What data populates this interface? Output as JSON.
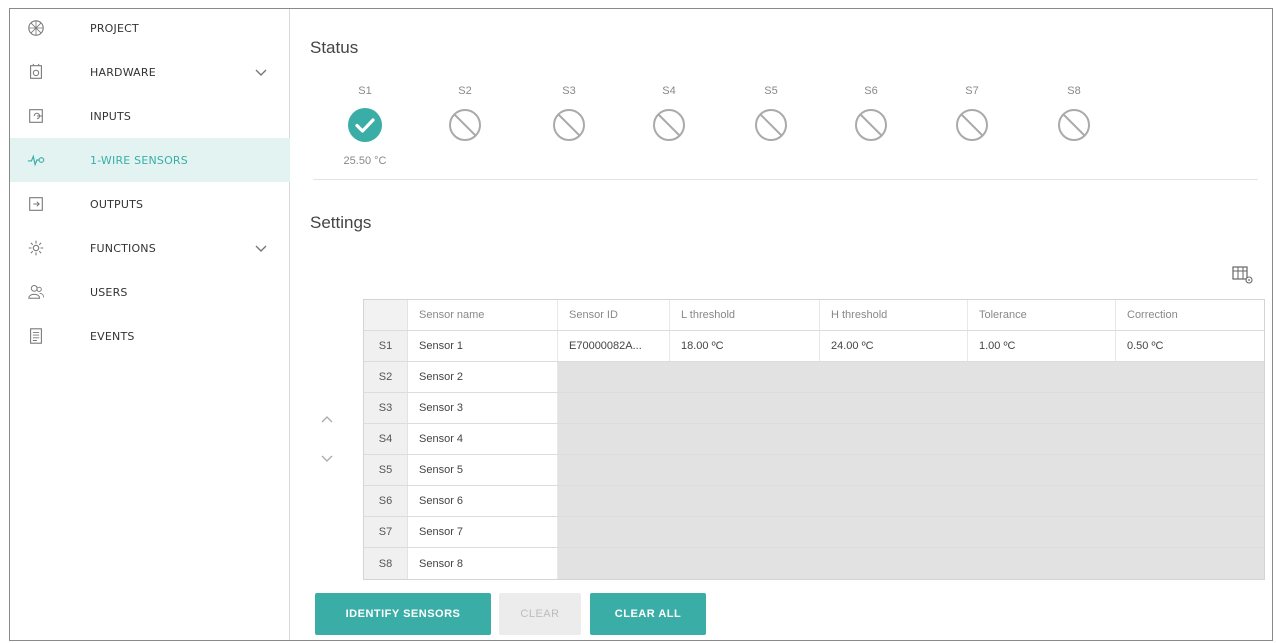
{
  "sidebar": {
    "items": [
      {
        "label": "PROJECT",
        "icon": "project-icon",
        "has_chevron": false,
        "active": false
      },
      {
        "label": "HARDWARE",
        "icon": "hardware-icon",
        "has_chevron": true,
        "active": false
      },
      {
        "label": "INPUTS",
        "icon": "inputs-icon",
        "has_chevron": false,
        "active": false
      },
      {
        "label": "1-WIRE SENSORS",
        "icon": "sensor-icon",
        "has_chevron": false,
        "active": true
      },
      {
        "label": "OUTPUTS",
        "icon": "outputs-icon",
        "has_chevron": false,
        "active": false
      },
      {
        "label": "FUNCTIONS",
        "icon": "functions-icon",
        "has_chevron": true,
        "active": false
      },
      {
        "label": "USERS",
        "icon": "users-icon",
        "has_chevron": false,
        "active": false
      },
      {
        "label": "EVENTS",
        "icon": "events-icon",
        "has_chevron": false,
        "active": false
      }
    ]
  },
  "status": {
    "title": "Status",
    "sensors": [
      {
        "label": "S1",
        "state": "ok",
        "temp": "25.50 °C"
      },
      {
        "label": "S2",
        "state": "disabled",
        "temp": ""
      },
      {
        "label": "S3",
        "state": "disabled",
        "temp": ""
      },
      {
        "label": "S4",
        "state": "disabled",
        "temp": ""
      },
      {
        "label": "S5",
        "state": "disabled",
        "temp": ""
      },
      {
        "label": "S6",
        "state": "disabled",
        "temp": ""
      },
      {
        "label": "S7",
        "state": "disabled",
        "temp": ""
      },
      {
        "label": "S8",
        "state": "disabled",
        "temp": ""
      }
    ]
  },
  "settings": {
    "title": "Settings",
    "columns": [
      "",
      "Sensor name",
      "Sensor ID",
      "L threshold",
      "H threshold",
      "Tolerance",
      "Correction"
    ],
    "rows": [
      {
        "idx": "S1",
        "name": "Sensor 1",
        "id": "E70000082A...",
        "l": "18.00 ºC",
        "h": "24.00 ºC",
        "tol": "1.00 ºC",
        "corr": "0.50 ºC"
      },
      {
        "idx": "S2",
        "name": "Sensor 2",
        "id": "",
        "l": "",
        "h": "",
        "tol": "",
        "corr": ""
      },
      {
        "idx": "S3",
        "name": "Sensor 3",
        "id": "",
        "l": "",
        "h": "",
        "tol": "",
        "corr": ""
      },
      {
        "idx": "S4",
        "name": "Sensor 4",
        "id": "",
        "l": "",
        "h": "",
        "tol": "",
        "corr": ""
      },
      {
        "idx": "S5",
        "name": "Sensor 5",
        "id": "",
        "l": "",
        "h": "",
        "tol": "",
        "corr": ""
      },
      {
        "idx": "S6",
        "name": "Sensor 6",
        "id": "",
        "l": "",
        "h": "",
        "tol": "",
        "corr": ""
      },
      {
        "idx": "S7",
        "name": "Sensor 7",
        "id": "",
        "l": "",
        "h": "",
        "tol": "",
        "corr": ""
      },
      {
        "idx": "S8",
        "name": "Sensor 8",
        "id": "",
        "l": "",
        "h": "",
        "tol": "",
        "corr": ""
      }
    ]
  },
  "buttons": {
    "identify": "IDENTIFY SENSORS",
    "clear": "CLEAR",
    "clear_all": "CLEAR ALL"
  },
  "colors": {
    "accent": "#3aaea6",
    "active_bg": "#e3f3f2"
  }
}
